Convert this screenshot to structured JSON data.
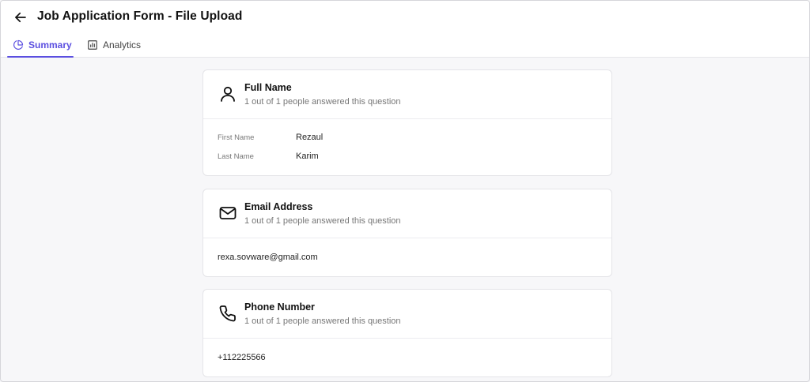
{
  "header": {
    "title": "Job Application Form - File Upload",
    "back_icon": "arrow-left-icon"
  },
  "tabs": [
    {
      "label": "Summary",
      "icon": "pie-chart-icon",
      "active": true
    },
    {
      "label": "Analytics",
      "icon": "bar-chart-icon",
      "active": false
    }
  ],
  "colors": {
    "accent": "#5b4fe0",
    "background": "#f7f7f9"
  },
  "questions": [
    {
      "title": "Full Name",
      "icon": "user-icon",
      "responses": "1 out of 1 people answered this question",
      "fields": [
        {
          "label": "First Name",
          "value": "Rezaul"
        },
        {
          "label": "Last Name",
          "value": "Karim"
        }
      ]
    },
    {
      "title": "Email Address",
      "icon": "mail-icon",
      "responses": "1 out of 1 people answered this question",
      "answer": "rexa.sovware@gmail.com"
    },
    {
      "title": "Phone Number",
      "icon": "phone-icon",
      "responses": "1 out of 1 people answered this question",
      "answer": "+112225566"
    }
  ]
}
